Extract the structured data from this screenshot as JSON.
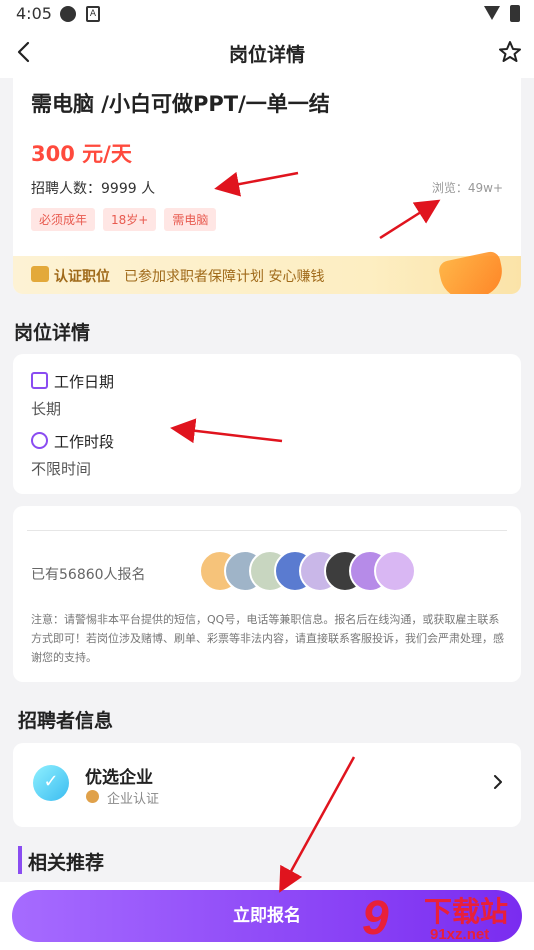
{
  "status_bar": {
    "time": "4:05",
    "notif_badge": "A"
  },
  "nav": {
    "title": "岗位详情"
  },
  "job": {
    "title": "需电脑 /小白可做PPT/一单一结",
    "salary": "300 元/天",
    "recruit_count": "招聘人数：9999 人",
    "views": "浏览：49w+",
    "tags": [
      "必须成年",
      "18岁+",
      "需电脑"
    ],
    "certification": {
      "label": "认证职位",
      "text": "已参加求职者保障计划  安心赚钱"
    }
  },
  "details": {
    "heading": "岗位详情",
    "work_date_label": "工作日期",
    "work_date_value": "长期",
    "work_time_label": "工作时段",
    "work_time_value": "不限时间"
  },
  "signup": {
    "count_text": "已有56860人报名",
    "notice": "注意：请警惕非本平台提供的短信，QQ号，电话等兼职信息。报名后在线沟通，或获取雇主联系方式即可！若岗位涉及赌博、刷单、彩票等非法内容，请直接联系客服投诉，我们会严肃处理，感谢您的支持。",
    "avatar_colors": [
      "#f6c37a",
      "#9fb4c8",
      "#c8d6c0",
      "#5a7bd0",
      "#c9b7e8",
      "#3d3d3d",
      "#b68be8",
      "#d9b7f3"
    ]
  },
  "recruiter": {
    "heading": "招聘者信息",
    "company_name": "优选企业",
    "company_cert": "企业认证"
  },
  "related": {
    "heading": "相关推荐"
  },
  "apply_button": "立即报名",
  "watermark": {
    "logo": "9",
    "text": "下载站",
    "url": "91xz.net"
  },
  "annotation_color": "#e0141e"
}
